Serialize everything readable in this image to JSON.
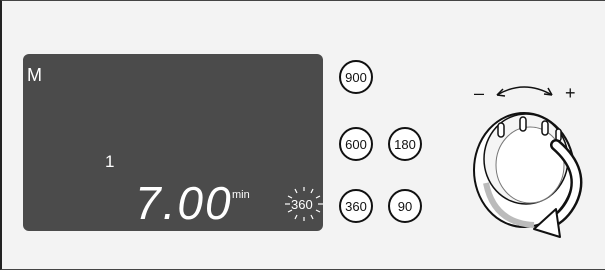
{
  "display": {
    "mode_letter": "M",
    "level_number": "1",
    "time_value": "7.00",
    "time_unit": "min",
    "selected_power": "360"
  },
  "buttons": [
    {
      "label": "900"
    },
    {
      "label": "600"
    },
    {
      "label": "180"
    },
    {
      "label": "360"
    },
    {
      "label": "90"
    }
  ],
  "dial": {
    "minus_label": "–",
    "plus_label": "+"
  }
}
